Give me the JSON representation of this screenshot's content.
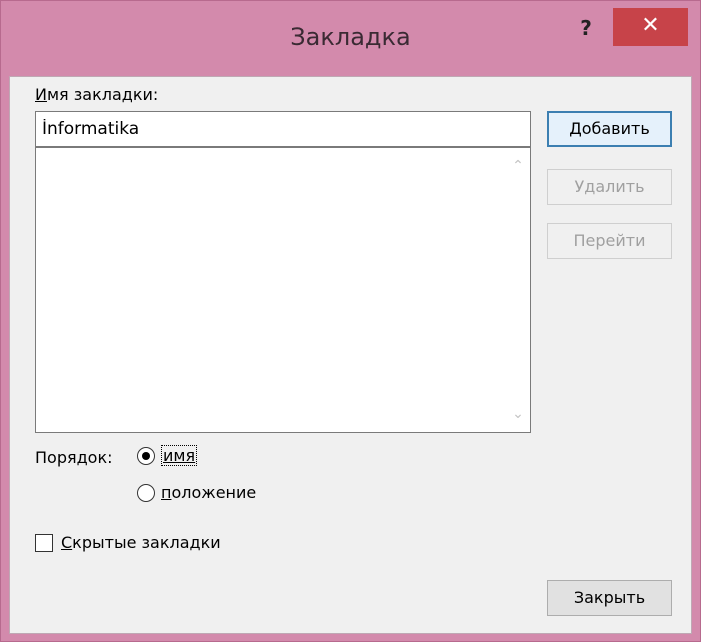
{
  "window": {
    "title": "Закладка",
    "help": "?",
    "close": "✕"
  },
  "form": {
    "name_label_ul": "И",
    "name_label_rest": "мя закладки:",
    "name_value": "İnformatika",
    "scroll_up": "⌃",
    "scroll_down": "⌄",
    "order_label": "Порядок:",
    "radio_name_label": "имя",
    "radio_pos_ul": "п",
    "radio_pos_rest": "оложение",
    "hidden_ul": "С",
    "hidden_rest": "крытые закладки",
    "radio_selected": "имя",
    "hidden_checked": false
  },
  "buttons": {
    "add_ul": "Д",
    "add_rest": "обавить",
    "delete": "Удалить",
    "goto": "Перейти",
    "close": "Закрыть"
  },
  "colors": {
    "title_bar": "#d38aac",
    "close_button": "#c74349",
    "primary_border": "#3c7fb1"
  }
}
